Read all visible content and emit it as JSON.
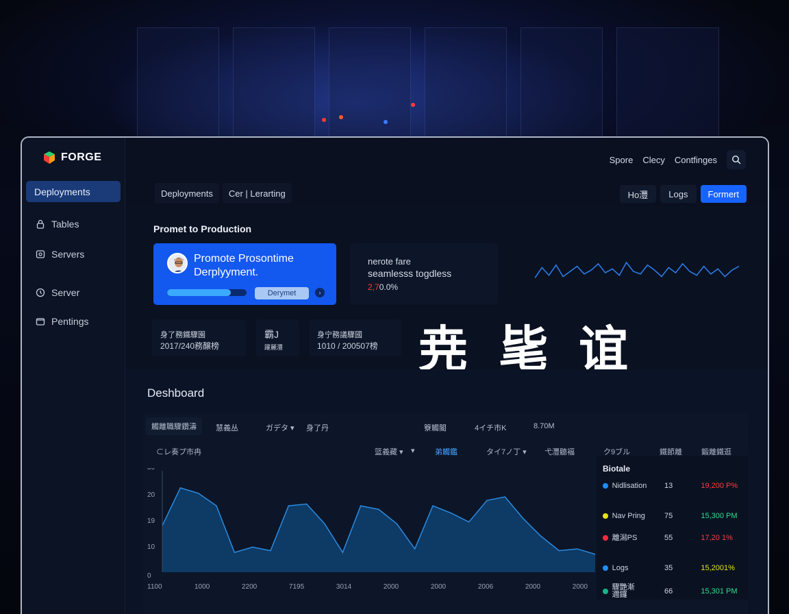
{
  "brand": {
    "name": "FORGE"
  },
  "colors": {
    "accent": "#1763ff",
    "promo_bg": "#1358ef",
    "active_nav": "#1a3a78",
    "chart_fill": "#0e3a66",
    "chart_line": "#2a8be0"
  },
  "sidebar": {
    "items": [
      {
        "label": "Deployments",
        "icon": "rocket-icon",
        "active": true
      },
      {
        "label": "Tables",
        "icon": "lock-icon"
      },
      {
        "label": "Servers",
        "icon": "server-icon"
      },
      {
        "label": "Server",
        "icon": "clock-icon"
      },
      {
        "label": "Pentings",
        "icon": "folder-icon"
      }
    ]
  },
  "header": {
    "links": [
      "Spore",
      "Clecy",
      "Contfinges"
    ],
    "search_icon": "search-icon"
  },
  "tabs": [
    "Deployments",
    "Cer | Lerarting"
  ],
  "actions": {
    "hold": "Ho灃",
    "logs": "Logs",
    "primary": "Formert"
  },
  "promo_section": {
    "title": "Promet to Production"
  },
  "promo_card": {
    "title": "Promote Prosontime Derplyyment.",
    "button": "Derymet",
    "progress": 0.8,
    "arrow": "›"
  },
  "stat_card": {
    "line1": "nerote fare",
    "line2": "seamlesss togdless",
    "value_red": "2,7",
    "value_rest": "0.0%"
  },
  "mini_cards": [
    {
      "t1": "身了務鐵驟園",
      "t2": "2017/240務醸榜"
    },
    {
      "t1": "霸J",
      "t2": "躍麗灃"
    },
    {
      "t1": "身宁務議驟國",
      "t2": "1010 / 200507榜"
    }
  ],
  "big_glyphs": "尭 毞 谊",
  "dashboard": {
    "title": "Deshboard",
    "columns": [
      "觸離職驟鑽濤",
      "慧義丛",
      "ガデタ ▾",
      "身了丹",
      "簝觸閽",
      "4イチ市K",
      "8.70M"
    ],
    "subheads": [
      "⊂レ奏プ市冉",
      "篮義藏 ▾",
      "▾",
      "弟觸鑑",
      "タイ7ノ丁 ▾",
      "弋灃聽褔",
      "ク9ブル",
      "鐵節離",
      "鍛離鐵逛"
    ],
    "y_axis": [
      "50",
      "20",
      "19",
      "10",
      "0"
    ],
    "x_axis": [
      "1100",
      "1000",
      "2200",
      "7195",
      "3014",
      "2000",
      "2000",
      "2006",
      "2000",
      "2000"
    ]
  },
  "legend": {
    "title": "Biotale",
    "rows": [
      {
        "name": "Nidlisation",
        "count": "13",
        "value": "19,200 P%",
        "dot": "#1e8cff",
        "value_color": "#ff3b3b"
      },
      {
        "name": "Nav Pring",
        "count": "75",
        "value": "15,300 PM",
        "dot": "#e6e21a",
        "value_color": "#2ee08a"
      },
      {
        "name": "離潟PS",
        "count": "55",
        "value": "17,20 1%",
        "dot": "#ff2b3b",
        "value_color": "#ff3b3b"
      },
      {
        "name": "Logs",
        "count": "35",
        "value": "15,2001%",
        "dot": "#1e8cff",
        "value_color": "#e6e21a"
      },
      {
        "name": "驟艷漸\n邇鑼",
        "count": "66",
        "value": "15,301 PM",
        "dot": "#16b38a",
        "value_color": "#2ee08a"
      }
    ]
  },
  "chart_data": {
    "type": "area",
    "title": "",
    "xlabel": "",
    "ylabel": "",
    "y_ticks": [
      "50",
      "20",
      "19",
      "10",
      "0"
    ],
    "x_ticks": [
      "1100",
      "1000",
      "2200",
      "7195",
      "3014",
      "2000",
      "2000",
      "2006",
      "2000",
      "2000"
    ],
    "ylim": [
      0,
      55
    ],
    "series": [
      {
        "values": [
          26,
          47,
          44,
          37,
          11,
          14,
          12,
          37,
          38,
          27,
          11,
          37,
          35,
          27,
          13,
          37,
          33,
          28,
          40,
          42,
          30,
          20,
          12,
          13,
          10
        ]
      }
    ],
    "grid": false
  },
  "sparkline": {
    "values": [
      4,
      12,
      6,
      14,
      5,
      9,
      13,
      7,
      10,
      15,
      8,
      11,
      6,
      16,
      9,
      7,
      14,
      10,
      5,
      12,
      8,
      15,
      9,
      6,
      13,
      7,
      11,
      5,
      10,
      13
    ]
  }
}
